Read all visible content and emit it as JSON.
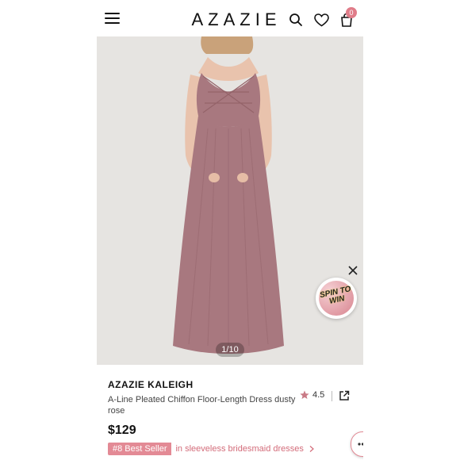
{
  "header": {
    "brand": "AZAZIE",
    "cart_count": "0"
  },
  "icons": {
    "menu": "hamburger-menu-icon",
    "search": "search-icon",
    "wishlist": "heart-icon",
    "cart": "shopping-bag-icon",
    "close": "close-icon",
    "rating_star": "star-icon",
    "share": "share-icon",
    "chevron": "chevron-right-icon",
    "chat": "chat-icon"
  },
  "gallery": {
    "pager": "1/10",
    "dress_color": "#a8787f"
  },
  "promo": {
    "spin_label": "SPIN TO WIN"
  },
  "product": {
    "name": "AZAZIE KALEIGH",
    "description": "A-Line Pleated Chiffon Floor-Length Dress dusty rose",
    "rating": "4.5",
    "price": "$129",
    "best_seller_badge": "#8 Best Seller",
    "best_seller_category": "in sleeveless bridesmaid dresses"
  },
  "colors": {
    "accent": "#e38a95",
    "accent_text": "#d36c7a"
  }
}
